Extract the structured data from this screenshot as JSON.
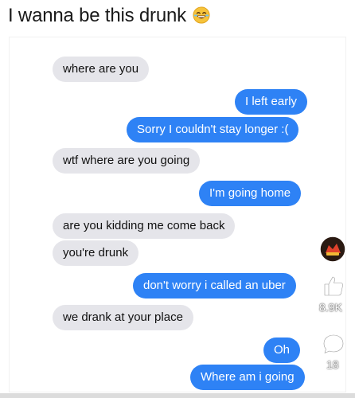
{
  "post": {
    "title": "I wanna be this drunk",
    "emoji_icon": "laughing-face-emoji-icon"
  },
  "messages": [
    {
      "from": "them",
      "text": "where are you"
    },
    {
      "from": "me",
      "text": "I left early"
    },
    {
      "from": "me",
      "text": "Sorry I couldn't stay longer :("
    },
    {
      "from": "them",
      "text": "wtf where are you going"
    },
    {
      "from": "me",
      "text": "I'm going home"
    },
    {
      "from": "them",
      "text": "are you kidding me come back"
    },
    {
      "from": "them",
      "text": "you're drunk"
    },
    {
      "from": "me",
      "text": "don't worry i called an uber"
    },
    {
      "from": "them",
      "text": "we drank at your place"
    },
    {
      "from": "me",
      "text": "Oh"
    },
    {
      "from": "me",
      "text": "Where am i going"
    }
  ],
  "actions": {
    "avatar_icon": "profile-avatar-icon",
    "like_icon": "thumbs-up-icon",
    "like_count": "8.9K",
    "comment_icon": "comment-bubble-icon",
    "comment_count": "18"
  },
  "colors": {
    "incoming_bubble": "#e5e5ea",
    "outgoing_bubble": "#2e82f5"
  }
}
